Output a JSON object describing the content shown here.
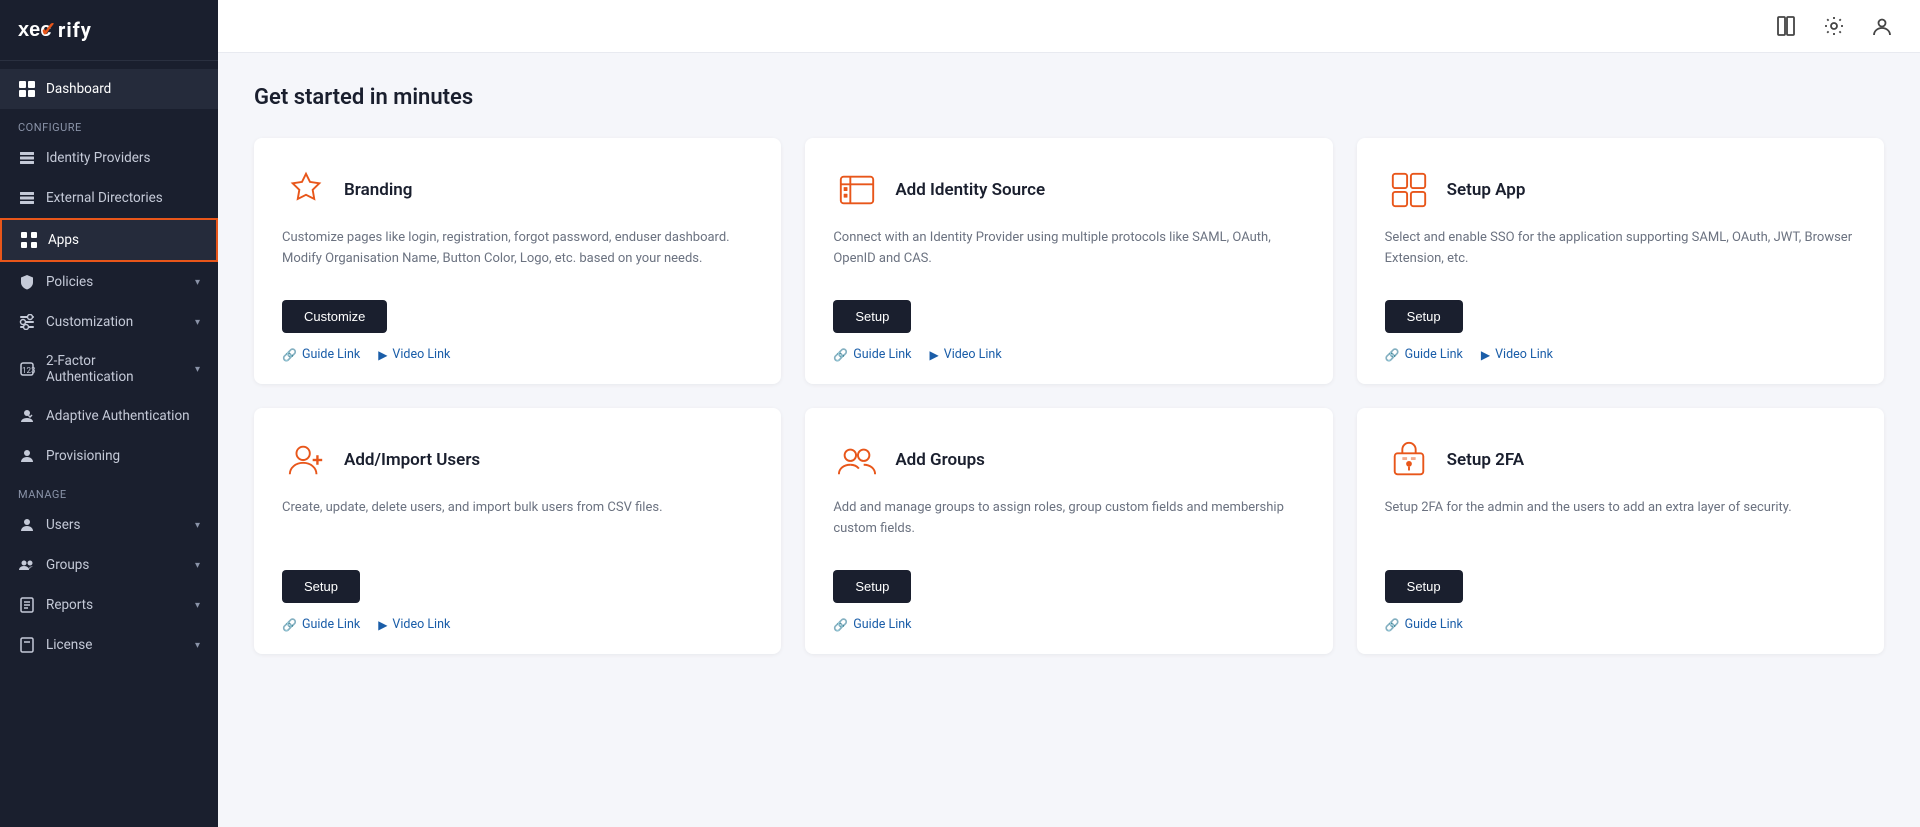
{
  "logo": {
    "text_before": "xec",
    "check": "✓",
    "text_after": "rify"
  },
  "sidebar": {
    "active_item": "dashboard",
    "highlighted_item": "apps",
    "section_configure": "Configure",
    "section_manage": "Manage",
    "items": [
      {
        "id": "dashboard",
        "label": "Dashboard",
        "icon": "grid"
      },
      {
        "id": "identity-providers",
        "label": "Identity Providers",
        "icon": "id-card"
      },
      {
        "id": "external-directories",
        "label": "External Directories",
        "icon": "list"
      },
      {
        "id": "apps",
        "label": "Apps",
        "icon": "apps-grid"
      },
      {
        "id": "policies",
        "label": "Policies",
        "icon": "shield",
        "has_chevron": true
      },
      {
        "id": "customization",
        "label": "Customization",
        "icon": "sliders",
        "has_chevron": true
      },
      {
        "id": "2fa",
        "label": "2-Factor Authentication",
        "icon": "hash",
        "has_chevron": true
      },
      {
        "id": "adaptive-auth",
        "label": "Adaptive Authentication",
        "icon": "person-shield"
      },
      {
        "id": "provisioning",
        "label": "Provisioning",
        "icon": "person-check"
      },
      {
        "id": "users",
        "label": "Users",
        "icon": "person",
        "has_chevron": true
      },
      {
        "id": "groups",
        "label": "Groups",
        "icon": "people",
        "has_chevron": true
      },
      {
        "id": "reports",
        "label": "Reports",
        "icon": "report",
        "has_chevron": true
      },
      {
        "id": "license",
        "label": "License",
        "icon": "license",
        "has_chevron": true
      }
    ]
  },
  "topbar": {
    "book_icon": "📖",
    "settings_icon": "⚙",
    "user_icon": "👤"
  },
  "main": {
    "title": "Get started in minutes",
    "cards": [
      {
        "id": "branding",
        "title": "Branding",
        "desc": "Customize pages like login, registration, forgot password, enduser dashboard. Modify Organisation Name, Button Color, Logo, etc. based on your needs.",
        "btn_label": "Customize",
        "links": [
          {
            "id": "guide",
            "label": "Guide Link",
            "icon": "🔗"
          },
          {
            "id": "video",
            "label": "Video Link",
            "icon": "▶"
          }
        ],
        "icon_type": "star"
      },
      {
        "id": "add-identity-source",
        "title": "Add Identity Source",
        "desc": "Connect with an Identity Provider using multiple protocols like SAML, OAuth, OpenID and CAS.",
        "btn_label": "Setup",
        "links": [
          {
            "id": "guide",
            "label": "Guide Link",
            "icon": "🔗"
          },
          {
            "id": "video",
            "label": "Video Link",
            "icon": "▶"
          }
        ],
        "icon_type": "id-source"
      },
      {
        "id": "setup-app",
        "title": "Setup App",
        "desc": "Select and enable SSO for the application supporting SAML, OAuth, JWT, Browser Extension, etc.",
        "btn_label": "Setup",
        "links": [
          {
            "id": "guide",
            "label": "Guide Link",
            "icon": "🔗"
          },
          {
            "id": "video",
            "label": "Video Link",
            "icon": "▶"
          }
        ],
        "icon_type": "app-grid"
      },
      {
        "id": "add-users",
        "title": "Add/Import Users",
        "desc": "Create, update, delete users, and import bulk users from CSV files.",
        "btn_label": "Setup",
        "links": [
          {
            "id": "guide",
            "label": "Guide Link",
            "icon": "🔗"
          },
          {
            "id": "video",
            "label": "Video Link",
            "icon": "▶"
          }
        ],
        "icon_type": "add-user"
      },
      {
        "id": "add-groups",
        "title": "Add Groups",
        "desc": "Add and manage groups to assign roles, group custom fields and membership custom fields.",
        "btn_label": "Setup",
        "links": [
          {
            "id": "guide",
            "label": "Guide Link",
            "icon": "🔗"
          }
        ],
        "icon_type": "group"
      },
      {
        "id": "setup-2fa",
        "title": "Setup 2FA",
        "desc": "Setup 2FA for the admin and the users to add an extra layer of security.",
        "btn_label": "Setup",
        "links": [
          {
            "id": "guide",
            "label": "Guide Link",
            "icon": "🔗"
          }
        ],
        "icon_type": "lock-2fa"
      }
    ]
  }
}
